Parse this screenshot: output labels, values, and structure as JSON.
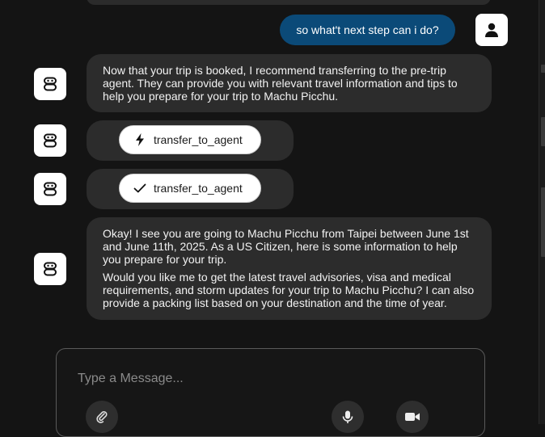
{
  "user_message": "so what't next step can i do?",
  "bot_message_1": "Now that your trip is booked, I recommend transferring to the pre-trip agent. They can provide you with relevant travel information and tips to help you prepare for your trip to Machu Picchu.",
  "tool_call": {
    "label": "transfer_to_agent",
    "icon": "lightning-icon"
  },
  "tool_result": {
    "label": "transfer_to_agent",
    "icon": "check-icon"
  },
  "bot_message_2": {
    "paragraph_1": "Okay! I see you are going to Machu Picchu from Taipei between June 1st and June 11th, 2025. As a US Citizen, here is some information to help you prepare for your trip.",
    "paragraph_2": "Would you like me to get the latest travel advisories, visa and medical requirements, and storm updates for your trip to Machu Picchu? I can also provide a packing list based on your destination and the time of year."
  },
  "composer": {
    "placeholder": "Type a Message..."
  },
  "icons": [
    "user-icon",
    "bot-icon",
    "paperclip-icon",
    "microphone-icon",
    "video-icon"
  ],
  "colors": {
    "background": "#141414",
    "bubble": "#2c2c2c",
    "user_bubble": "#0b4a78",
    "avatar": "#ffffff"
  }
}
